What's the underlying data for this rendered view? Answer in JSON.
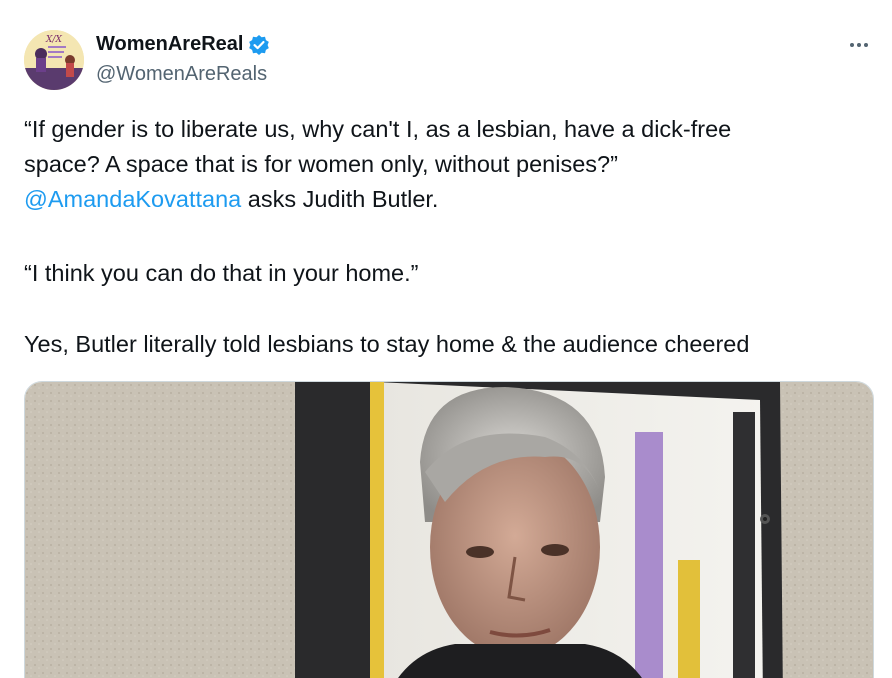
{
  "author": {
    "display_name": "WomenAreReal",
    "handle": "@WomenAreReals",
    "avatar_icon": "avatar-image",
    "verified_icon": "verified-badge-icon",
    "accent_color": "#1d9bf0"
  },
  "more_icon": "more-options-icon",
  "tweet_text": {
    "line1": "“If gender is to liberate us, why can't I, as a lesbian, have a dick-free",
    "line2": "space? A space that is for women only, without penises?”",
    "mention": "@AmandaKovattana",
    "line3_rest": " asks Judith Butler.",
    "line4": "“I think you can do that in your home.”",
    "line5": "Yes, Butler literally told lesbians to stay home & the audience cheered"
  },
  "media": {
    "type": "photo",
    "alt_icon": "tweet-photo"
  }
}
